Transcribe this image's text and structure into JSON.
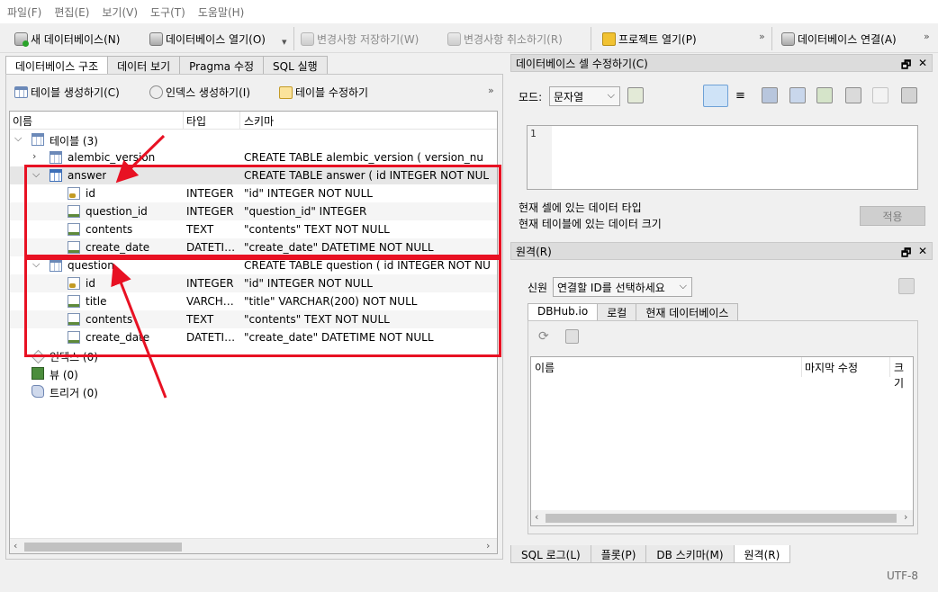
{
  "menu": [
    "파일(F)",
    "편집(E)",
    "보기(V)",
    "도구(T)",
    "도움말(H)"
  ],
  "toolbar": {
    "new_db": "새 데이터베이스(N)",
    "open_db": "데이터베이스 열기(O)",
    "save_changes": "변경사항 저장하기(W)",
    "revert_changes": "변경사항 취소하기(R)",
    "open_project": "프로젝트 열기(P)",
    "attach_db": "데이터베이스 연결(A)",
    "overflow": "»"
  },
  "left_tabs": [
    "데이터베이스 구조",
    "데이터 보기",
    "Pragma 수정",
    "SQL 실행"
  ],
  "structure_toolbar": {
    "create_table": "테이블 생성하기(C)",
    "create_index": "인덱스 생성하기(I)",
    "modify_table": "테이블 수정하기",
    "overflow": "»"
  },
  "tree": {
    "columns": [
      "이름",
      "타입",
      "스키마"
    ],
    "rows": [
      {
        "name": "테이블 (3)",
        "type": "",
        "schema": ""
      },
      {
        "name": "alembic_version",
        "type": "",
        "schema": "CREATE TABLE alembic_version ( version_nu"
      },
      {
        "name": "answer",
        "type": "",
        "schema": "CREATE TABLE answer ( id INTEGER NOT NUL"
      },
      {
        "name": "id",
        "type": "INTEGER",
        "schema": "\"id\" INTEGER NOT NULL"
      },
      {
        "name": "question_id",
        "type": "INTEGER",
        "schema": "\"question_id\" INTEGER"
      },
      {
        "name": "contents",
        "type": "TEXT",
        "schema": "\"contents\" TEXT NOT NULL"
      },
      {
        "name": "create_date",
        "type": "DATETI…",
        "schema": "\"create_date\" DATETIME NOT NULL"
      },
      {
        "name": "question",
        "type": "",
        "schema": "CREATE TABLE question ( id INTEGER NOT NU"
      },
      {
        "name": "id",
        "type": "INTEGER",
        "schema": "\"id\" INTEGER NOT NULL"
      },
      {
        "name": "title",
        "type": "VARCH…",
        "schema": "\"title\" VARCHAR(200) NOT NULL"
      },
      {
        "name": "contents",
        "type": "TEXT",
        "schema": "\"contents\" TEXT NOT NULL"
      },
      {
        "name": "create_date",
        "type": "DATETI…",
        "schema": "\"create_date\" DATETIME NOT NULL"
      },
      {
        "name": "인덱스 (0)",
        "type": "",
        "schema": ""
      },
      {
        "name": "뷰 (0)",
        "type": "",
        "schema": ""
      },
      {
        "name": "트리거 (0)",
        "type": "",
        "schema": ""
      }
    ]
  },
  "edit_cell": {
    "title": "데이터베이스 셀 수정하기(C)",
    "mode_label": "모드:",
    "mode_value": "문자열",
    "line_number": "1",
    "cell_type_text": "현재 셀에 있는 데이터 타입",
    "cell_size_text": "현재 테이블에 있는 데이터 크기",
    "apply": "적용"
  },
  "remote": {
    "title": "원격(R)",
    "identity_label": "신원",
    "identity_value": "연결할 ID를 선택하세요",
    "tabs": [
      "DBHub.io",
      "로컬",
      "현재 데이터베이스"
    ],
    "columns": [
      "이름",
      "마지막 수정",
      "크기"
    ]
  },
  "bottom_tabs": [
    "SQL 로그(L)",
    "플롯(P)",
    "DB 스키마(M)",
    "원격(R)"
  ],
  "status": {
    "encoding": "UTF-8"
  },
  "dock_controls": {
    "float": "🗗",
    "close": "✕"
  },
  "colors": {
    "annotation_red": "#e81123",
    "selection": "#e6e6e6"
  }
}
